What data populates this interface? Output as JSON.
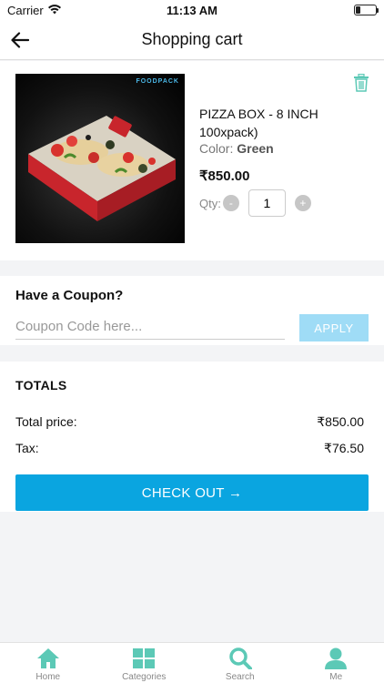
{
  "status_bar": {
    "carrier": "Carrier",
    "time": "11:13 AM"
  },
  "nav": {
    "title": "Shopping cart"
  },
  "cart_item": {
    "brand": "FOODPACK",
    "name": "PIZZA BOX - 8 INCH 100xpack)",
    "color_label": "Color:",
    "color_value": "Green",
    "price": "₹850.00",
    "qty_label": "Qty:",
    "qty_minus": "-",
    "qty_value": "1",
    "qty_plus": "+"
  },
  "coupon": {
    "title": "Have a Coupon?",
    "placeholder": "Coupon Code here...",
    "apply_label": "APPLY"
  },
  "totals": {
    "title": "TOTALS",
    "rows": [
      {
        "label": "Total price:",
        "value": "₹850.00"
      },
      {
        "label": "Tax:",
        "value": "₹76.50"
      }
    ],
    "checkout_label": "CHECK OUT →"
  },
  "tabs": [
    {
      "label": "Home",
      "icon": "home-icon"
    },
    {
      "label": "Categories",
      "icon": "grid-icon"
    },
    {
      "label": "Search",
      "icon": "search-icon"
    },
    {
      "label": "Me",
      "icon": "user-icon"
    }
  ],
  "colors": {
    "accent": "#0aa5e0",
    "apply_disabled": "#9fdcf6",
    "tab_icon": "#5cc9b6"
  }
}
